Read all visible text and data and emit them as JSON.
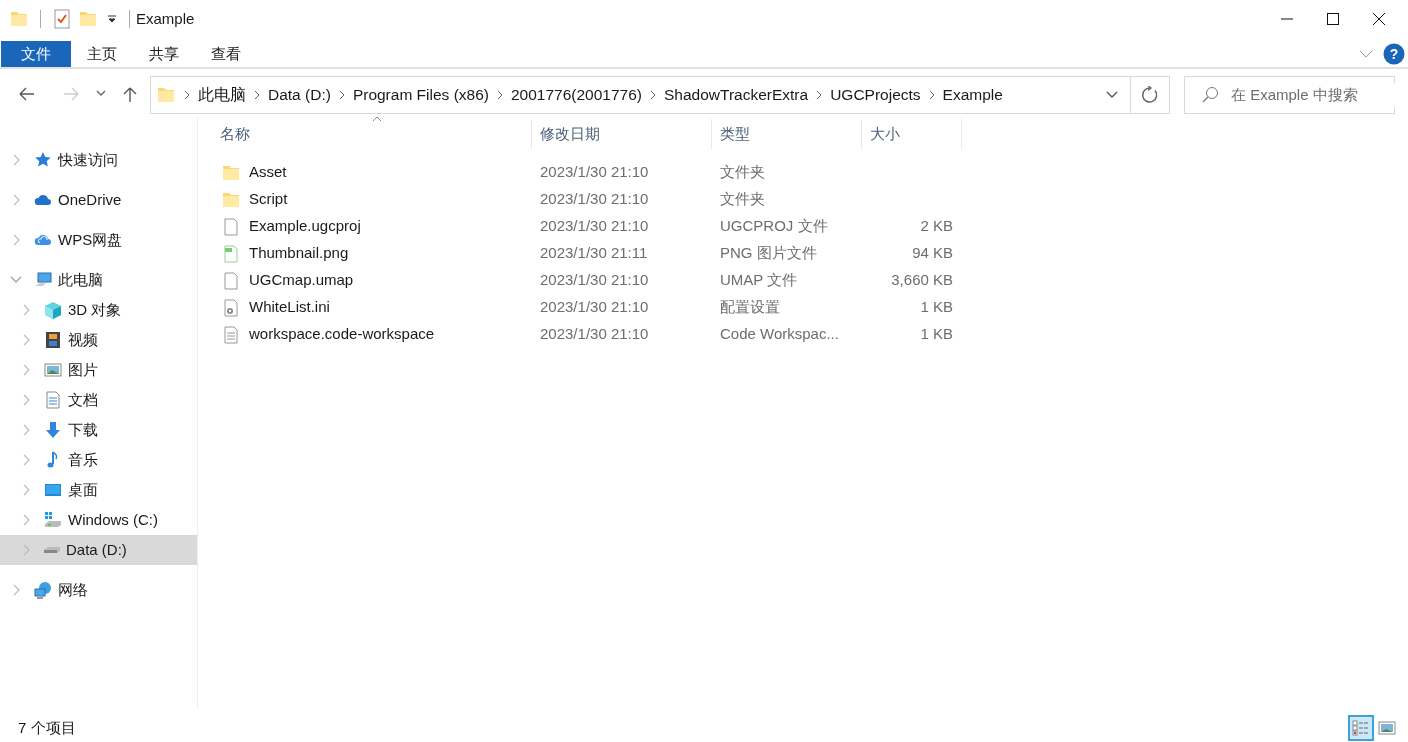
{
  "window": {
    "title": "Example"
  },
  "ribbon_tabs": [
    {
      "label": "文件",
      "selected": true
    },
    {
      "label": "主页",
      "selected": false
    },
    {
      "label": "共享",
      "selected": false
    },
    {
      "label": "查看",
      "selected": false
    }
  ],
  "help_button": {
    "label": "?"
  },
  "address_bar": {
    "breadcrumbs": [
      "此电脑",
      "Data (D:)",
      "Program Files (x86)",
      "2001776(2001776)",
      "ShadowTrackerExtra",
      "UGCProjects",
      "Example"
    ]
  },
  "search": {
    "placeholder": "在 Example 中搜索"
  },
  "sidebar": {
    "items": [
      {
        "label": "快速访问",
        "kind": "star",
        "expanded": false,
        "selected": false
      },
      {
        "label": "OneDrive",
        "kind": "cloud",
        "expanded": false,
        "selected": false
      },
      {
        "label": "WPS网盘",
        "kind": "wpscloud",
        "expanded": false,
        "selected": false
      },
      {
        "label": "此电脑",
        "kind": "pc",
        "expanded": true,
        "selected": false,
        "children": [
          {
            "label": "3D 对象",
            "kind": "cube",
            "expanded": false,
            "selected": false
          },
          {
            "label": "视频",
            "kind": "film",
            "expanded": false,
            "selected": false
          },
          {
            "label": "图片",
            "kind": "picture",
            "expanded": false,
            "selected": false
          },
          {
            "label": "文档",
            "kind": "document",
            "expanded": false,
            "selected": false
          },
          {
            "label": "下载",
            "kind": "download",
            "expanded": false,
            "selected": false
          },
          {
            "label": "音乐",
            "kind": "music",
            "expanded": false,
            "selected": false
          },
          {
            "label": "桌面",
            "kind": "desktop",
            "expanded": false,
            "selected": false
          },
          {
            "label": "Windows (C:)",
            "kind": "sysdrive",
            "expanded": false,
            "selected": false
          },
          {
            "label": "Data (D:)",
            "kind": "drive",
            "expanded": false,
            "selected": true
          }
        ]
      },
      {
        "label": "网络",
        "kind": "network",
        "expanded": false,
        "selected": false
      }
    ]
  },
  "table": {
    "columns": [
      {
        "label": "名称",
        "sorted": true
      },
      {
        "label": "修改日期",
        "sorted": false
      },
      {
        "label": "类型",
        "sorted": false
      },
      {
        "label": "大小",
        "sorted": false
      }
    ],
    "rows": [
      {
        "kind": "folder",
        "name": "Asset",
        "modified": "2023/1/30 21:10",
        "type": "文件夹"
      },
      {
        "kind": "folder",
        "name": "Script",
        "modified": "2023/1/30 21:10",
        "type": "文件夹"
      },
      {
        "kind": "file",
        "name": "Example.ugcproj",
        "modified": "2023/1/30 21:10",
        "type": "UGCPROJ 文件",
        "size": "2 KB"
      },
      {
        "kind": "image",
        "name": "Thumbnail.png",
        "modified": "2023/1/30 21:11",
        "type": "PNG 图片文件",
        "size": "94 KB"
      },
      {
        "kind": "file",
        "name": "UGCmap.umap",
        "modified": "2023/1/30 21:10",
        "type": "UMAP 文件",
        "size": "3,660 KB"
      },
      {
        "kind": "settings",
        "name": "WhiteList.ini",
        "modified": "2023/1/30 21:10",
        "type": "配置设置",
        "size": "1 KB"
      },
      {
        "kind": "text",
        "name": "workspace.code-workspace",
        "modified": "2023/1/30 21:10",
        "type": "Code Workspac...",
        "size": "1 KB"
      }
    ]
  },
  "status_bar": {
    "item_count": "7 个项目",
    "views": [
      {
        "kind": "details",
        "selected": true
      },
      {
        "kind": "thumbnails",
        "selected": false
      }
    ]
  }
}
